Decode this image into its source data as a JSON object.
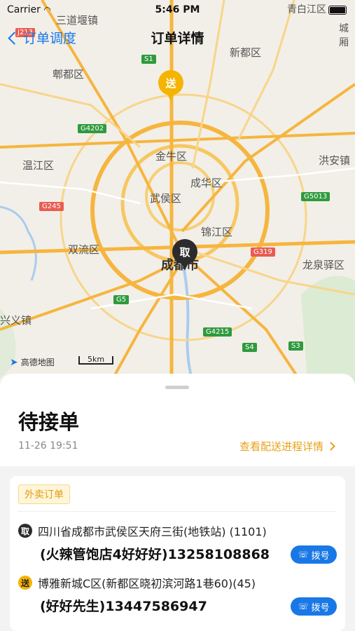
{
  "status_bar": {
    "carrier": "Carrier",
    "time": "5:46 PM"
  },
  "nav": {
    "back_label": "订单调度",
    "title": "订单详情"
  },
  "map": {
    "district_labels": [
      "三道堰镇",
      "青白江区",
      "城厢",
      "郫都区",
      "新都区",
      "金牛区",
      "温江区",
      "洪安镇",
      "成华区",
      "武侯区",
      "锦江区",
      "双流区",
      "成都市",
      "龙泉驿区",
      "兴义镇"
    ],
    "road_shields": [
      "J213",
      "S1",
      "G4202",
      "G245",
      "G5013",
      "G319",
      "G5",
      "G4215",
      "S4",
      "S3"
    ],
    "logo_text": "高德地图",
    "scale_text": "5km",
    "send_marker": "送",
    "pickup_marker": "取"
  },
  "order": {
    "status": "待接单",
    "time": "11-26 19:51",
    "progress_link": "查看配送进程详情",
    "type_tag": "外卖订单",
    "pickup": {
      "badge": "取",
      "address": "四川省成都市武侯区天府三街(地铁站) (1101)",
      "contact": "(火辣管饱店4好好好)13258108868",
      "call_label": "拨号"
    },
    "delivery": {
      "badge": "送",
      "address": "博雅新城C区(新都区晓初滨河路1巷60)(45)",
      "contact": "(好好先生)13447586947",
      "call_label": "拨号"
    }
  },
  "colors": {
    "accent_blue": "#1a78e6",
    "accent_orange": "#e8a21a",
    "send_yellow": "#f5b400",
    "road_orange": "#f6b53e"
  }
}
